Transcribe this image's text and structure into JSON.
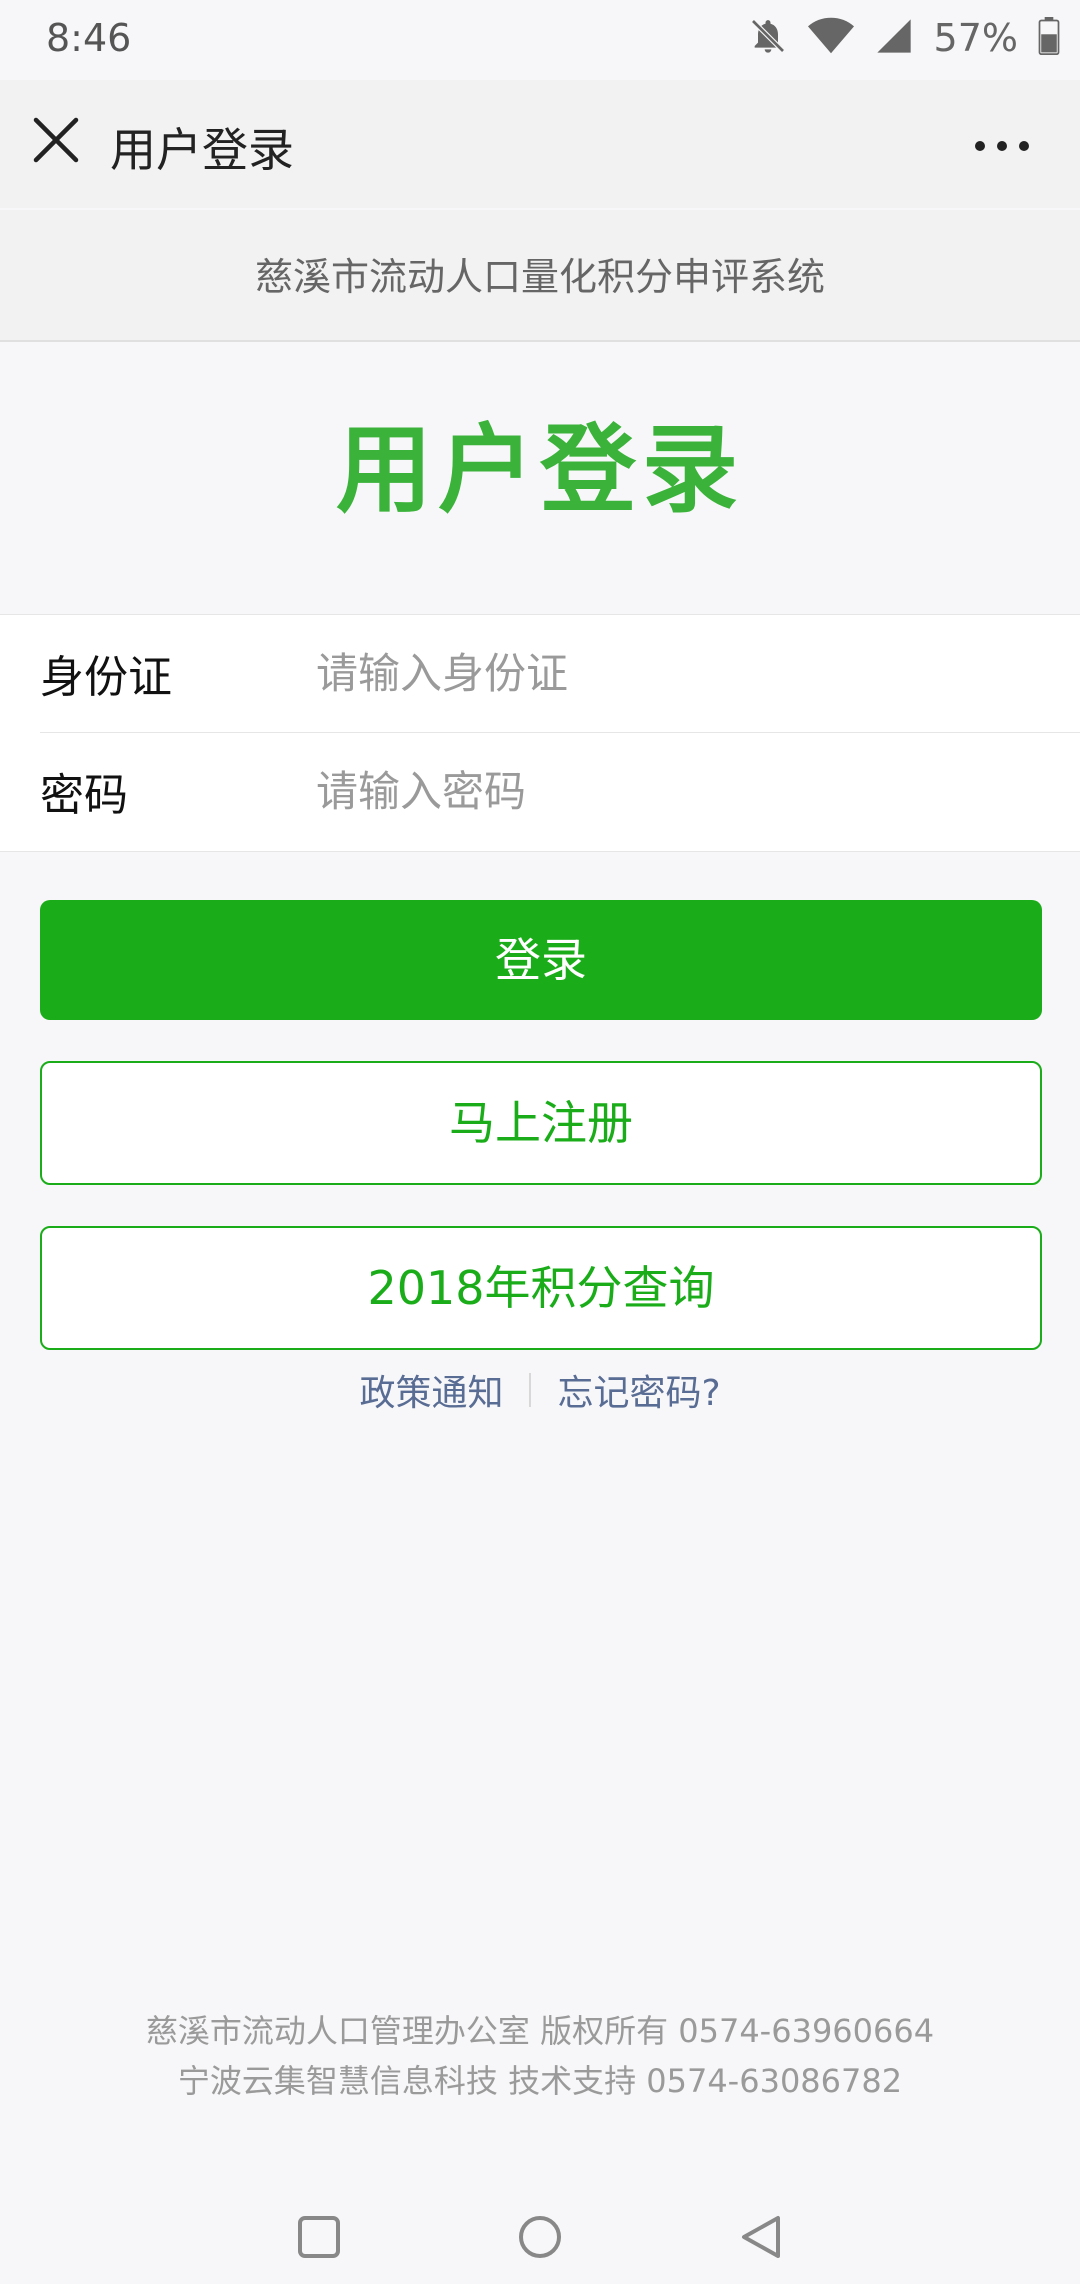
{
  "status_bar": {
    "time": "8:46",
    "battery": "57%",
    "icons": [
      "bell-off-icon",
      "wifi-icon",
      "signal-icon",
      "battery-icon"
    ]
  },
  "nav": {
    "title": "用户登录",
    "close_icon": "close-icon",
    "more_icon": "more-icon"
  },
  "system_title": "慈溪市流动人口量化积分申评系统",
  "heading": "用户登录",
  "form": {
    "id_label": "身份证",
    "id_placeholder": "请输入身份证",
    "id_value": "",
    "password_label": "密码",
    "password_placeholder": "请输入密码",
    "password_value": ""
  },
  "buttons": {
    "login": "登录",
    "register": "马上注册",
    "query": "2018年积分查询"
  },
  "links": {
    "policy": "政策通知",
    "forgot": "忘记密码?"
  },
  "footer": {
    "line1": "慈溪市流动人口管理办公室 版权所有 0574-63960664",
    "line2": "宁波云集智慧信息科技 技术支持 0574-63086782"
  },
  "colors": {
    "brand_green": "#1aad19",
    "heading_green": "#3bb33a",
    "link_color": "#586c94"
  }
}
